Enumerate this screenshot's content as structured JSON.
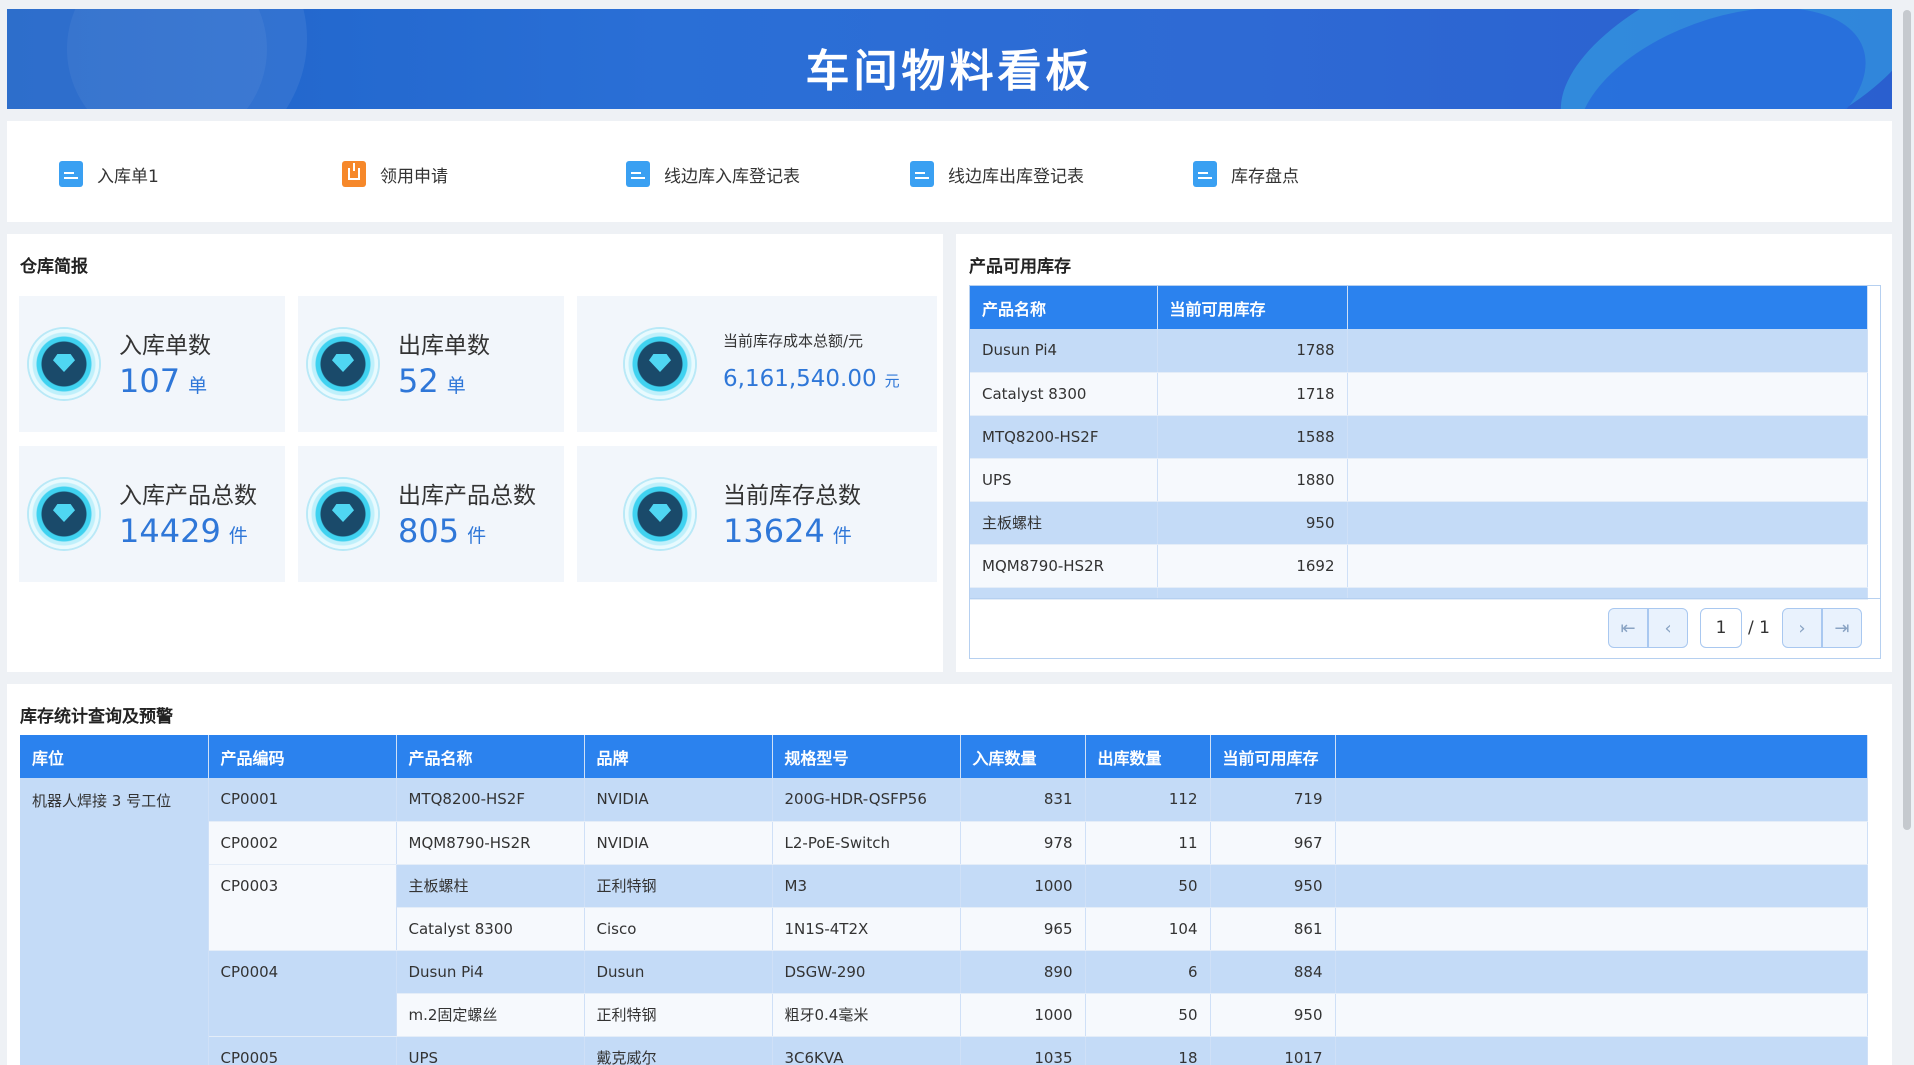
{
  "header": {
    "title": "车间物料看板"
  },
  "quick_links": [
    {
      "label": "入库单1",
      "icon": "document-icon",
      "color": "#3aa0f2"
    },
    {
      "label": "领用申请",
      "icon": "org-tree-icon",
      "color": "#f6882a"
    },
    {
      "label": "线边库入库登记表",
      "icon": "document-icon",
      "color": "#3aa0f2"
    },
    {
      "label": "线边库出库登记表",
      "icon": "document-icon",
      "color": "#3aa0f2"
    },
    {
      "label": "库存盘点",
      "icon": "document-icon",
      "color": "#3aa0f2"
    }
  ],
  "warehouse_summary": {
    "title": "仓库简报",
    "cards": [
      {
        "name": "入库单数",
        "value": "107",
        "unit": "单"
      },
      {
        "name": "出库单数",
        "value": "52",
        "unit": "单"
      },
      {
        "name": "当前库存成本总额/元",
        "value": "6,161,540.00",
        "unit": "元"
      },
      {
        "name": "入库产品总数",
        "value": "14429",
        "unit": "件"
      },
      {
        "name": "出库产品总数",
        "value": "805",
        "unit": "件"
      },
      {
        "name": "当前库存总数",
        "value": "13624",
        "unit": "件"
      }
    ]
  },
  "available_stock": {
    "title": "产品可用库存",
    "columns": [
      "产品名称",
      "当前可用库存"
    ],
    "rows": [
      [
        "Dusun Pi4",
        "1788"
      ],
      [
        "Catalyst 8300",
        "1718"
      ],
      [
        "MTQ8200-HS2F",
        "1588"
      ],
      [
        "UPS",
        "1880"
      ],
      [
        "主板螺柱",
        "950"
      ],
      [
        "MQM8790-HS2R",
        "1692"
      ]
    ],
    "pager": {
      "current": "1",
      "total": "/ 1"
    }
  },
  "inventory_stats": {
    "title": "库存统计查询及预警",
    "columns": [
      "库位",
      "产品编码",
      "产品名称",
      "品牌",
      "规格型号",
      "入库数量",
      "出库数量",
      "当前可用库存"
    ],
    "location": "机器人焊接 3 号工位",
    "rows": [
      {
        "code": "CP0001",
        "name": "MTQ8200-HS2F",
        "brand": "NVIDIA",
        "spec": "200G-HDR-QSFP56",
        "in": "831",
        "out": "112",
        "avail": "719"
      },
      {
        "code": "CP0002",
        "name": "MQM8790-HS2R",
        "brand": "NVIDIA",
        "spec": "L2-PoE-Switch",
        "in": "978",
        "out": "11",
        "avail": "967"
      },
      {
        "code": "CP0003",
        "name": "主板螺柱",
        "brand": "正利特钢",
        "spec": "M3",
        "in": "1000",
        "out": "50",
        "avail": "950"
      },
      {
        "code": "",
        "name": "Catalyst 8300",
        "brand": "Cisco",
        "spec": "1N1S-4T2X",
        "in": "965",
        "out": "104",
        "avail": "861"
      },
      {
        "code": "CP0004",
        "name": "Dusun Pi4",
        "brand": "Dusun",
        "spec": "DSGW-290",
        "in": "890",
        "out": "6",
        "avail": "884"
      },
      {
        "code": "",
        "name": "m.2固定螺丝",
        "brand": "正利特钢",
        "spec": "粗牙0.4毫米",
        "in": "1000",
        "out": "50",
        "avail": "950"
      },
      {
        "code": "CP0005",
        "name": "UPS",
        "brand": "戴克威尔",
        "spec": "3C6KVA",
        "in": "1035",
        "out": "18",
        "avail": "1017"
      }
    ]
  }
}
